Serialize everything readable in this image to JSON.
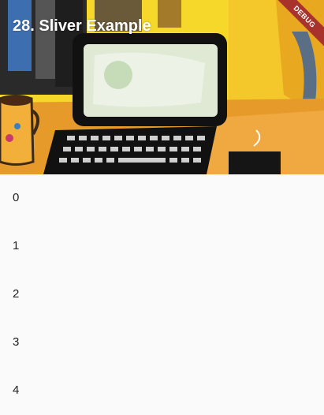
{
  "app_bar": {
    "title": "28. Sliver Example",
    "debug_banner": "DEBUG"
  },
  "list": {
    "items": [
      "0",
      "1",
      "2",
      "3",
      "4"
    ]
  },
  "colors": {
    "background": "#fafafa",
    "debug_banner": "#a8322c",
    "title_text": "#ffffff"
  }
}
